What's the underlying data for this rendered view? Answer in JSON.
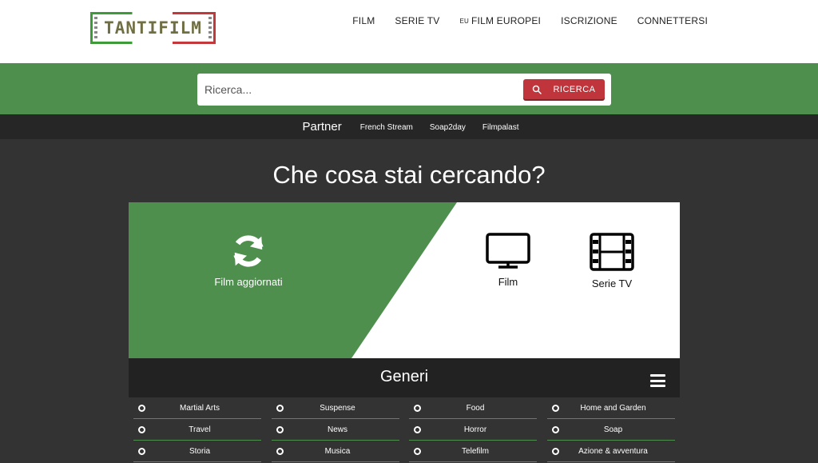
{
  "header": {
    "logo_text": "TANTIFILM",
    "nav": [
      {
        "label": "FILM"
      },
      {
        "label": "SERIE TV"
      },
      {
        "flag": "EU",
        "label": "FILM EUROPEI"
      },
      {
        "label": "ISCRIZIONE"
      },
      {
        "label": "CONNETTERSI"
      }
    ]
  },
  "search": {
    "placeholder": "Ricerca...",
    "value": "",
    "button_label": "RICERCA"
  },
  "partner": {
    "title": "Partner",
    "links": [
      "French Stream",
      "Soap2day",
      "Filmpalast"
    ]
  },
  "main": {
    "heading": "Che cosa stai cercando?",
    "categories": {
      "updated": {
        "label": "Film aggiornati",
        "icon": "refresh-icon"
      },
      "film": {
        "label": "Film",
        "icon": "monitor-icon"
      },
      "serie": {
        "label": "Serie TV",
        "icon": "film-strip-icon"
      }
    }
  },
  "generi": {
    "title": "Generi",
    "rows": [
      [
        "Martial Arts",
        "Suspense",
        "Food",
        "Home and Garden"
      ],
      [
        "Travel",
        "News",
        "Horror",
        "Soap"
      ],
      [
        "Storia",
        "Musica",
        "Telefilm",
        "Azione & avventura"
      ]
    ]
  },
  "colors": {
    "green": "#4e8f4e",
    "red_button": "#c0353b",
    "dark_bg": "#333333",
    "bar_bg": "#262626"
  }
}
